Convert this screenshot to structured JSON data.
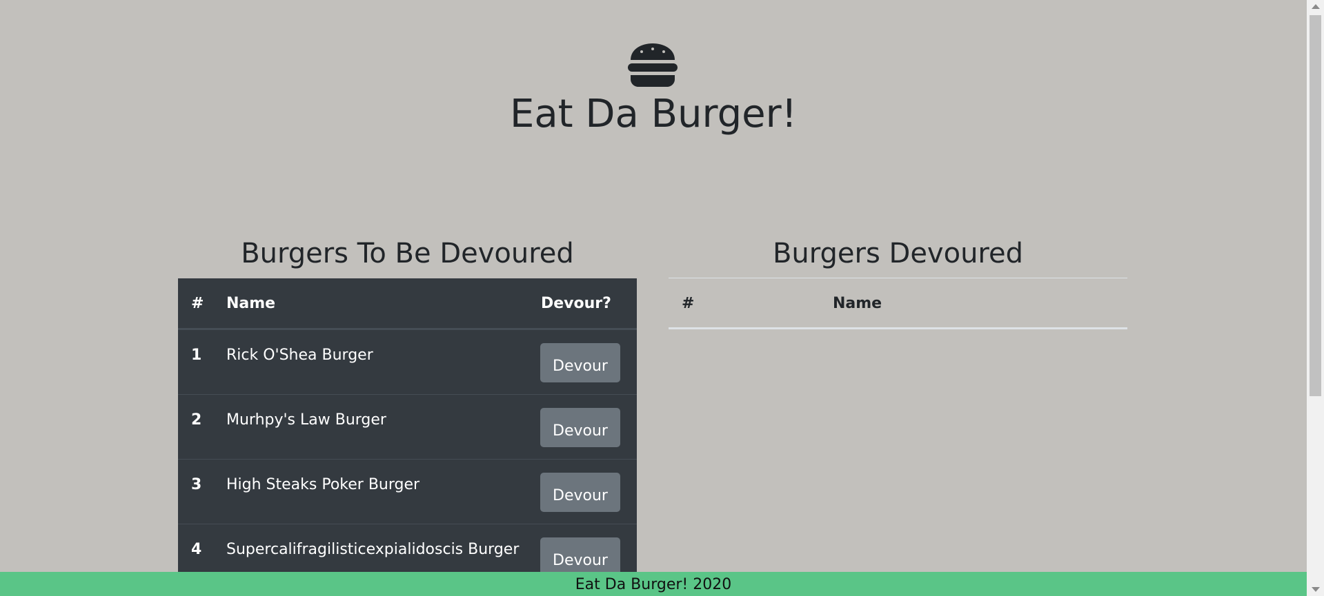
{
  "header": {
    "title": "Eat Da Burger!",
    "logo_icon": "hamburger-icon"
  },
  "to_devour": {
    "title": "Burgers To Be Devoured",
    "columns": [
      "#",
      "Name",
      "Devour?"
    ],
    "rows": [
      {
        "num": "1",
        "name": "Rick O'Shea Burger",
        "button": "Devour"
      },
      {
        "num": "2",
        "name": "Murhpy's Law Burger",
        "button": "Devour"
      },
      {
        "num": "3",
        "name": "High Steaks Poker Burger",
        "button": "Devour"
      },
      {
        "num": "4",
        "name": "Supercalifragilisticexpialidoscis Burger",
        "button": "Devour"
      }
    ]
  },
  "devoured": {
    "title": "Burgers Devoured",
    "columns": [
      "#",
      "Name"
    ],
    "rows": []
  },
  "footer": {
    "text": "Eat Da Burger! 2020"
  },
  "colors": {
    "background": "#c2c0bc",
    "dark_table": "#343a40",
    "button": "#6c757d",
    "footer": "#5ac587"
  }
}
